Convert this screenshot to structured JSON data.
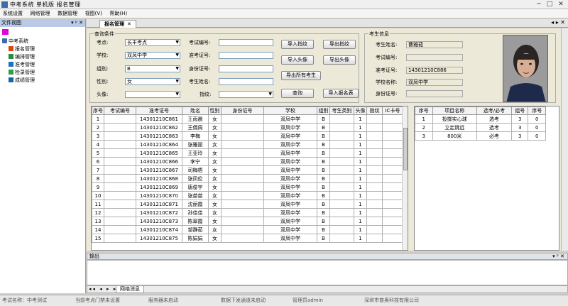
{
  "window": {
    "title": "中考系统  单机版  报名管理",
    "min": "─",
    "max": "□",
    "close": "✕"
  },
  "menu": [
    "系统设置",
    "网络管理",
    "数据管理",
    "视图(V)",
    "帮助(H)"
  ],
  "left_panel": {
    "title": "文件视图",
    "controls": "▾ ᵖ ✕",
    "root": "中考系统",
    "items": [
      "报名管理",
      "编排管理",
      "准考管理",
      "检录管理",
      "成绩管理"
    ],
    "item_colors": [
      "#d9480f",
      "#2b8a3e",
      "#1971c2",
      "#2f9e44",
      "#1864ab"
    ]
  },
  "tabs": {
    "active": "报名管理",
    "close": "✕",
    "controls": "◂ ▸ ✕"
  },
  "query": {
    "title": "查询条件",
    "exam_point_label": "考点:",
    "exam_point_value": "长丰考点",
    "school_label": "学校:",
    "school_value": "双凤中学",
    "group_label": "组别:",
    "group_value": "B",
    "gender_label": "性别:",
    "gender_value": "女",
    "head_label": "头像:",
    "head_value": "",
    "exam_no_label": "考试编号:",
    "ticket_label": "准考证号:",
    "id_label": "身份证号:",
    "name_label": "考生姓名:",
    "remark_label": "指纹:",
    "buttons": [
      "导入指纹",
      "导出指纹",
      "导入头像",
      "导出头像",
      "导出所有考生",
      "查询",
      "导入报名表"
    ]
  },
  "candidate": {
    "title": "考生信息",
    "name_label": "考生姓名:",
    "name_value": "曹雅茹",
    "exam_no_label": "考试编号:",
    "exam_no_value": "",
    "ticket_label": "准考证号:",
    "ticket_value": "14301210C886",
    "school_label": "学校名称:",
    "school_value": "双凤中学",
    "id_label": "身份证号:",
    "id_value": ""
  },
  "grid1": {
    "columns": [
      "序号",
      "考试编号",
      "准考证号",
      "姓名",
      "性别",
      "身份证号",
      "学校",
      "组别",
      "考生类别",
      "头像",
      "指纹",
      "IC卡号"
    ],
    "rows": [
      [
        "1",
        "",
        "14301210C861",
        "王雨晨",
        "女",
        "",
        "双凤中学",
        "B",
        "",
        "1",
        "",
        ""
      ],
      [
        "2",
        "",
        "14301210C862",
        "王佣周",
        "女",
        "",
        "双凤中学",
        "B",
        "",
        "1",
        "",
        ""
      ],
      [
        "3",
        "",
        "14301210C863",
        "李梅",
        "女",
        "",
        "双凤中学",
        "B",
        "",
        "1",
        "",
        ""
      ],
      [
        "4",
        "",
        "14301210C864",
        "张雅丽",
        "女",
        "",
        "双凤中学",
        "B",
        "",
        "1",
        "",
        ""
      ],
      [
        "5",
        "",
        "14301210C865",
        "王亚玲",
        "女",
        "",
        "双凤中学",
        "B",
        "",
        "1",
        "",
        ""
      ],
      [
        "6",
        "",
        "14301210C866",
        "李宁",
        "女",
        "",
        "双凤中学",
        "B",
        "",
        "1",
        "",
        ""
      ],
      [
        "7",
        "",
        "14301210C867",
        "司梅梧",
        "女",
        "",
        "双凤中学",
        "B",
        "",
        "1",
        "",
        ""
      ],
      [
        "8",
        "",
        "14301210C868",
        "张凤伦",
        "女",
        "",
        "双凤中学",
        "B",
        "",
        "1",
        "",
        ""
      ],
      [
        "9",
        "",
        "14301210C869",
        "唐俊宇",
        "女",
        "",
        "双凤中学",
        "B",
        "",
        "1",
        "",
        ""
      ],
      [
        "10",
        "",
        "14301210C870",
        "张苗苗",
        "女",
        "",
        "双凤中学",
        "B",
        "",
        "1",
        "",
        ""
      ],
      [
        "11",
        "",
        "14301210C871",
        "沈丽霞",
        "女",
        "",
        "双凤中学",
        "B",
        "",
        "1",
        "",
        ""
      ],
      [
        "12",
        "",
        "14301210C872",
        "孙佳佳",
        "女",
        "",
        "双凤中学",
        "B",
        "",
        "1",
        "",
        ""
      ],
      [
        "13",
        "",
        "14301210C873",
        "陈翠霞",
        "女",
        "",
        "双凤中学",
        "B",
        "",
        "1",
        "",
        ""
      ],
      [
        "14",
        "",
        "14301210C874",
        "邹静茹",
        "女",
        "",
        "双凤中学",
        "B",
        "",
        "1",
        "",
        ""
      ],
      [
        "15",
        "",
        "14301210C875",
        "陈娟娟",
        "女",
        "",
        "双凤中学",
        "B",
        "",
        "1",
        "",
        ""
      ]
    ]
  },
  "grid2": {
    "columns": [
      "序号",
      "项目名称",
      "选考/必考",
      "组号",
      "序号"
    ],
    "rows": [
      [
        "1",
        "投掷实心球",
        "选考",
        "3",
        "0"
      ],
      [
        "2",
        "立定跳远",
        "选考",
        "3",
        "0"
      ],
      [
        "3",
        "800米",
        "必考",
        "3",
        "0"
      ]
    ]
  },
  "output": {
    "title": "输出",
    "controls": "▾ ᵖ ✕",
    "nav": "◂◂ ◂ ▸ ▸▸",
    "tab": "网络消息"
  },
  "status": [
    "考试名称：中考测试",
    "当前考点门禁未设置",
    "服务器未启动",
    "数据下发通道未启动",
    "管理员admin",
    "深圳市普奥科技有限公司"
  ]
}
